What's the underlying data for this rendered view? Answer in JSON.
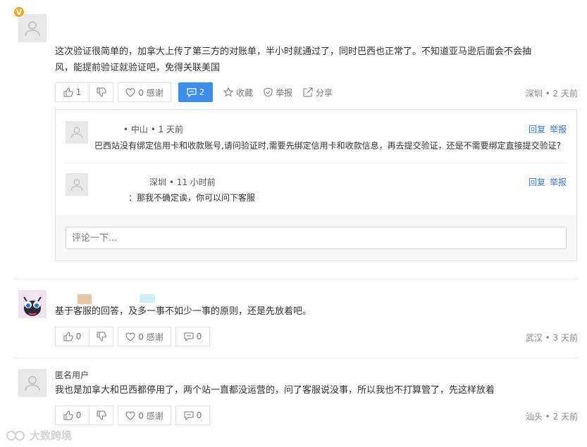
{
  "comments": [
    {
      "text_line1": "这次验证很简单的，加拿大上传了第三方的对账单，半小时就通过了，同时巴西也正常了。不知道亚马逊后面会不会抽",
      "text_line2": "风，能提前验证就验证吧，免得关联美国",
      "badge": "V",
      "likes": "1",
      "thanks": "0 感谢",
      "replies_count": "2",
      "collect": "收藏",
      "report": "举报",
      "share": "分享",
      "location_time": "深圳 • 2 天前"
    },
    {
      "text": "基于客服的回答，及多一事不如少一事的原则，还是先放着吧。",
      "likes": "0",
      "thanks": "0 感谢",
      "replies_count": "0",
      "location_time": "武汉 • 3 天前"
    },
    {
      "username": "匿名用户",
      "text": "我也是加拿大和巴西都停用了，两个站一直都没运营的，问了客服说没事，所以我也不打算管了，先这样放着",
      "likes": "0",
      "thanks": "0 感谢",
      "replies_count": "0",
      "location_time": "汕头 • 2 天前"
    }
  ],
  "replies": [
    {
      "meta": "• 中山 • 1 天前",
      "text": "巴西站没有绑定信用卡和收款账号,请问验证时,需要先绑定信用卡和收款信息，再去提交验证，还是不需要绑定直接提交验证?",
      "reply_label": "回复",
      "report_label": "举报"
    },
    {
      "meta": "深圳 • 11 小时前",
      "text": "：那我不确定诶，你可以问下客服",
      "reply_label": "回复",
      "report_label": "举报"
    }
  ],
  "comment_input": {
    "placeholder": "评论一下..."
  },
  "watermark": "大数跨境",
  "colors": {
    "accent": "#3c8ee8",
    "link": "#3b78c4",
    "badge": "#f5a623"
  }
}
